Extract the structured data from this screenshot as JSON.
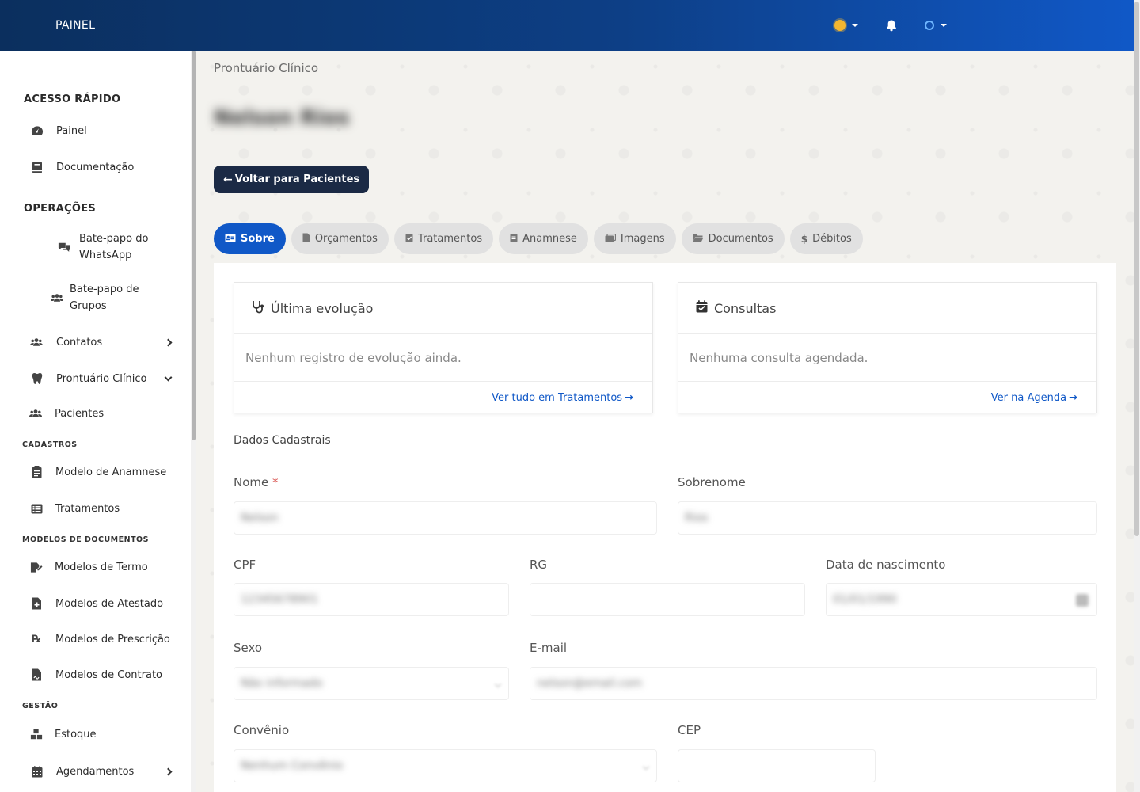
{
  "header": {
    "brand": "PAINEL"
  },
  "sidebar": {
    "sections": {
      "acesso_rapido": "ACESSO RÁPIDO",
      "operacoes": "OPERAÇÕES",
      "cadastros": "CADASTROS",
      "modelos_documentos": "MODELOS DE DOCUMENTOS",
      "gestao": "GESTÃO"
    },
    "items": {
      "painel": "Painel",
      "documentacao": "Documentação",
      "whatsapp_l1": "Bate-papo do",
      "whatsapp_l2": "WhatsApp",
      "grupos_l1": "Bate-papo de",
      "grupos_l2": "Grupos",
      "contatos": "Contatos",
      "prontuario": "Prontuário Clínico",
      "pacientes": "Pacientes",
      "modelo_anamnese": "Modelo de Anamnese",
      "tratamentos": "Tratamentos",
      "modelos_termo": "Modelos de Termo",
      "modelos_atestado": "Modelos de Atestado",
      "modelos_prescricao": "Modelos de Prescrição",
      "modelos_contrato": "Modelos de Contrato",
      "estoque": "Estoque",
      "agendamentos": "Agendamentos"
    }
  },
  "main": {
    "breadcrumb": "Prontuário Clínico",
    "patient_name": "Nelson Rios",
    "back_label": "Voltar para Pacientes",
    "tabs": [
      "Sobre",
      "Orçamentos",
      "Tratamentos",
      "Anamnese",
      "Imagens",
      "Documentos",
      "Débitos"
    ],
    "cards": {
      "evolucao": {
        "title": "Última evolução",
        "empty": "Nenhum registro de evolução ainda.",
        "link": "Ver tudo em Tratamentos"
      },
      "consultas": {
        "title": "Consultas",
        "empty": "Nenhuma consulta agendada.",
        "link": "Ver na Agenda"
      }
    },
    "form": {
      "section": "Dados Cadastrais",
      "nome": {
        "label": "Nome",
        "required": "*",
        "value": "Nelson"
      },
      "sobrenome": {
        "label": "Sobrenome",
        "value": "Rios"
      },
      "cpf": {
        "label": "CPF",
        "value": "12345678901"
      },
      "rg": {
        "label": "RG",
        "value": ""
      },
      "nascimento": {
        "label": "Data de nascimento",
        "value": "01/01/1990"
      },
      "sexo": {
        "label": "Sexo",
        "value": "Não informado"
      },
      "email": {
        "label": "E-mail",
        "value": "nelson@email.com"
      },
      "convenio": {
        "label": "Convênio",
        "value": "Nenhum Convênio"
      },
      "cep": {
        "label": "CEP",
        "value": ""
      }
    }
  },
  "colors": {
    "primary": "#1058c7",
    "dark_button": "#1b2a45",
    "topbar_start": "#0b2f5e",
    "topbar_end": "#1058c7"
  }
}
